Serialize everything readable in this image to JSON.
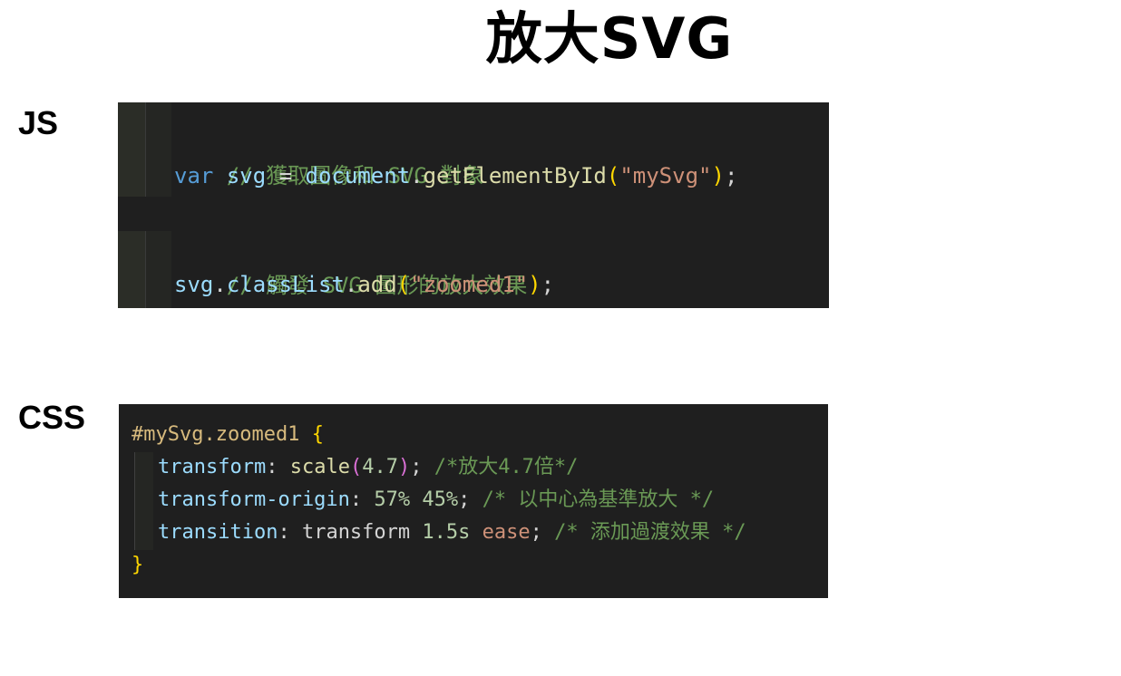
{
  "slide": {
    "title": "放大SVG",
    "js_label": "JS",
    "css_label": "CSS"
  },
  "js_code": {
    "comment1": "// 獲取圖像和 SVG 對象",
    "line2": {
      "kw": "var",
      "name": "svg",
      "eq": "=",
      "obj": "document",
      "dot": ".",
      "method": "getElementById",
      "open": "(",
      "arg": "\"mySvg\"",
      "close": ")",
      "semi": ";"
    },
    "comment2": "// 觸發 SVG 圖形的放大效果",
    "line5": {
      "obj": "svg",
      "dot1": ".",
      "prop": "classList",
      "dot2": ".",
      "method": "add",
      "open": "(",
      "arg": "\"zoomed1\"",
      "close": ")",
      "semi": ";"
    }
  },
  "css_code": {
    "selector": "#mySvg.zoomed1",
    "open_brace": "{",
    "close_brace": "}",
    "rules": [
      {
        "prop": "transform",
        "colon": ":",
        "fn": "scale",
        "open": "(",
        "val": "4.7",
        "close": ")",
        "semi": ";",
        "comment": "/*放大4.7倍*/"
      },
      {
        "prop": "transform-origin",
        "colon": ":",
        "val1": "57%",
        "val2": "45%",
        "semi": ";",
        "comment": "/* 以中心為基準放大 */"
      },
      {
        "prop": "transition",
        "colon": ":",
        "val1": "transform",
        "val2": "1.5s",
        "val3": "ease",
        "semi": ";",
        "comment": "/* 添加過渡效果 */"
      }
    ]
  }
}
